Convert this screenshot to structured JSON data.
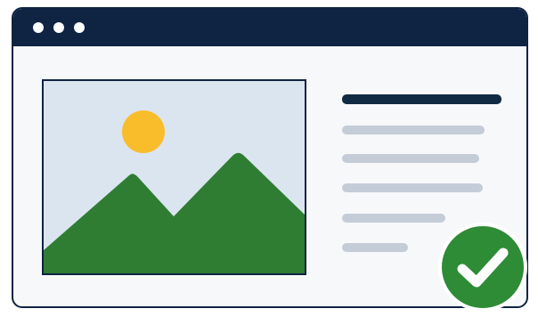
{
  "window": {
    "frame_color": "#0f2342",
    "window_controls": [
      "dot",
      "dot",
      "dot"
    ]
  },
  "image_placeholder": {
    "icon": "landscape-image-icon",
    "sky_color": "#dbe5ef",
    "sun_color": "#f9bd2b",
    "mountain_color": "#2e7d32"
  },
  "text_placeholder": {
    "heading_color": "#102a44",
    "line_color": "#c4ccd8",
    "line_count": 5
  },
  "status": {
    "icon": "checkmark-icon",
    "badge_color": "#2e8b36"
  }
}
